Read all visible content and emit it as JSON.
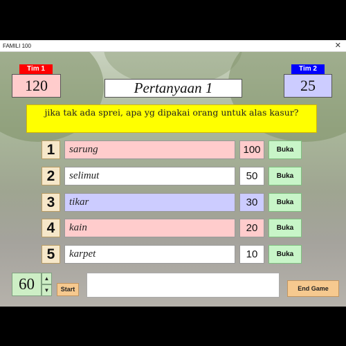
{
  "window": {
    "title": "FAMILI 100",
    "close_glyph": "✕"
  },
  "teams": [
    {
      "label": "Tim 1",
      "score": "120",
      "tag_color": "#ff0000",
      "score_bg": "#ffcccc"
    },
    {
      "label": "Tim 2",
      "score": "25",
      "tag_color": "#0000ff",
      "score_bg": "#ccccff"
    }
  ],
  "question": {
    "title": "Pertanyaan 1",
    "text": "jika tak ada sprei, apa yg dipakai orang untuk alas kasur?"
  },
  "answers": [
    {
      "num": "1",
      "text": "sarung",
      "points": "100",
      "row_color": "#ffcccc",
      "button": "Buka"
    },
    {
      "num": "2",
      "text": "selimut",
      "points": "50",
      "row_color": "#ffffff",
      "button": "Buka"
    },
    {
      "num": "3",
      "text": "tikar",
      "points": "30",
      "row_color": "#ccccff",
      "button": "Buka"
    },
    {
      "num": "4",
      "text": "kain",
      "points": "20",
      "row_color": "#ffcccc",
      "button": "Buka"
    },
    {
      "num": "5",
      "text": "karpet",
      "points": "10",
      "row_color": "#ffffff",
      "button": "Buka"
    }
  ],
  "controls": {
    "timer": "60",
    "spin_up_glyph": "▲",
    "spin_down_glyph": "▼",
    "start_label": "Start",
    "input_value": "",
    "end_label": "End Game"
  }
}
